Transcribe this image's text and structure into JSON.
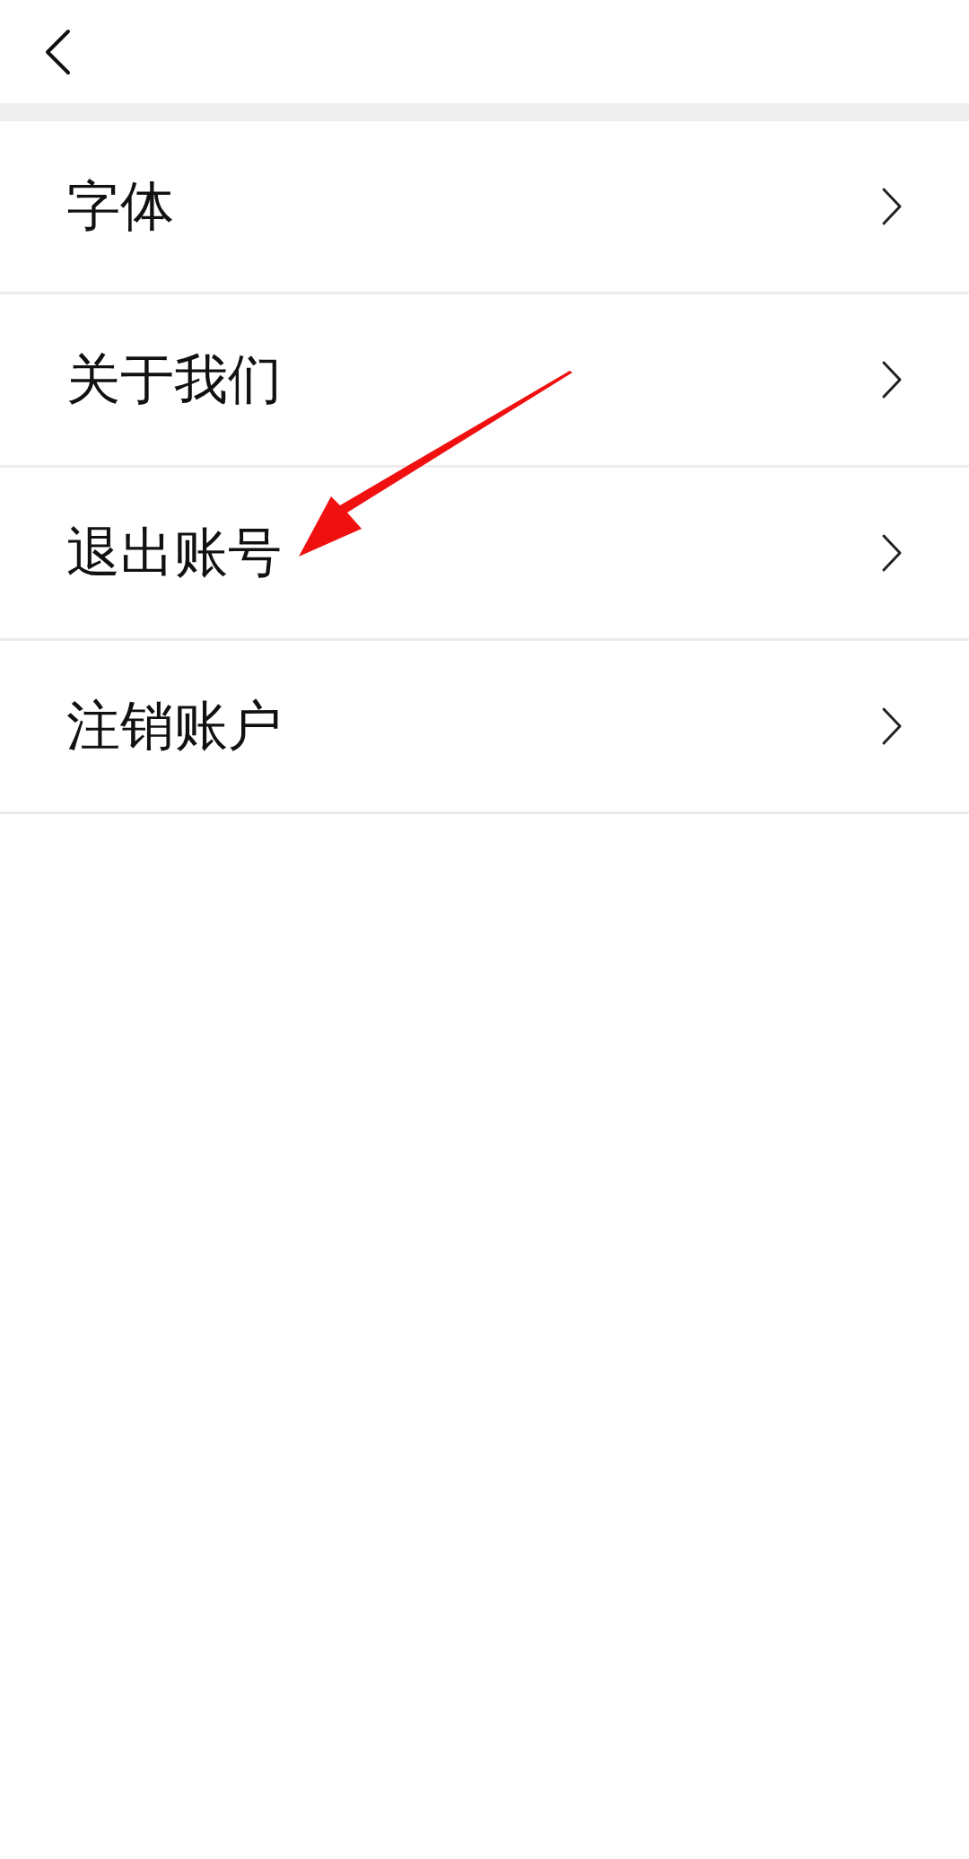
{
  "settings": {
    "items": [
      {
        "label": "字体"
      },
      {
        "label": "关于我们"
      },
      {
        "label": "退出账号"
      },
      {
        "label": "注销账户"
      }
    ]
  }
}
